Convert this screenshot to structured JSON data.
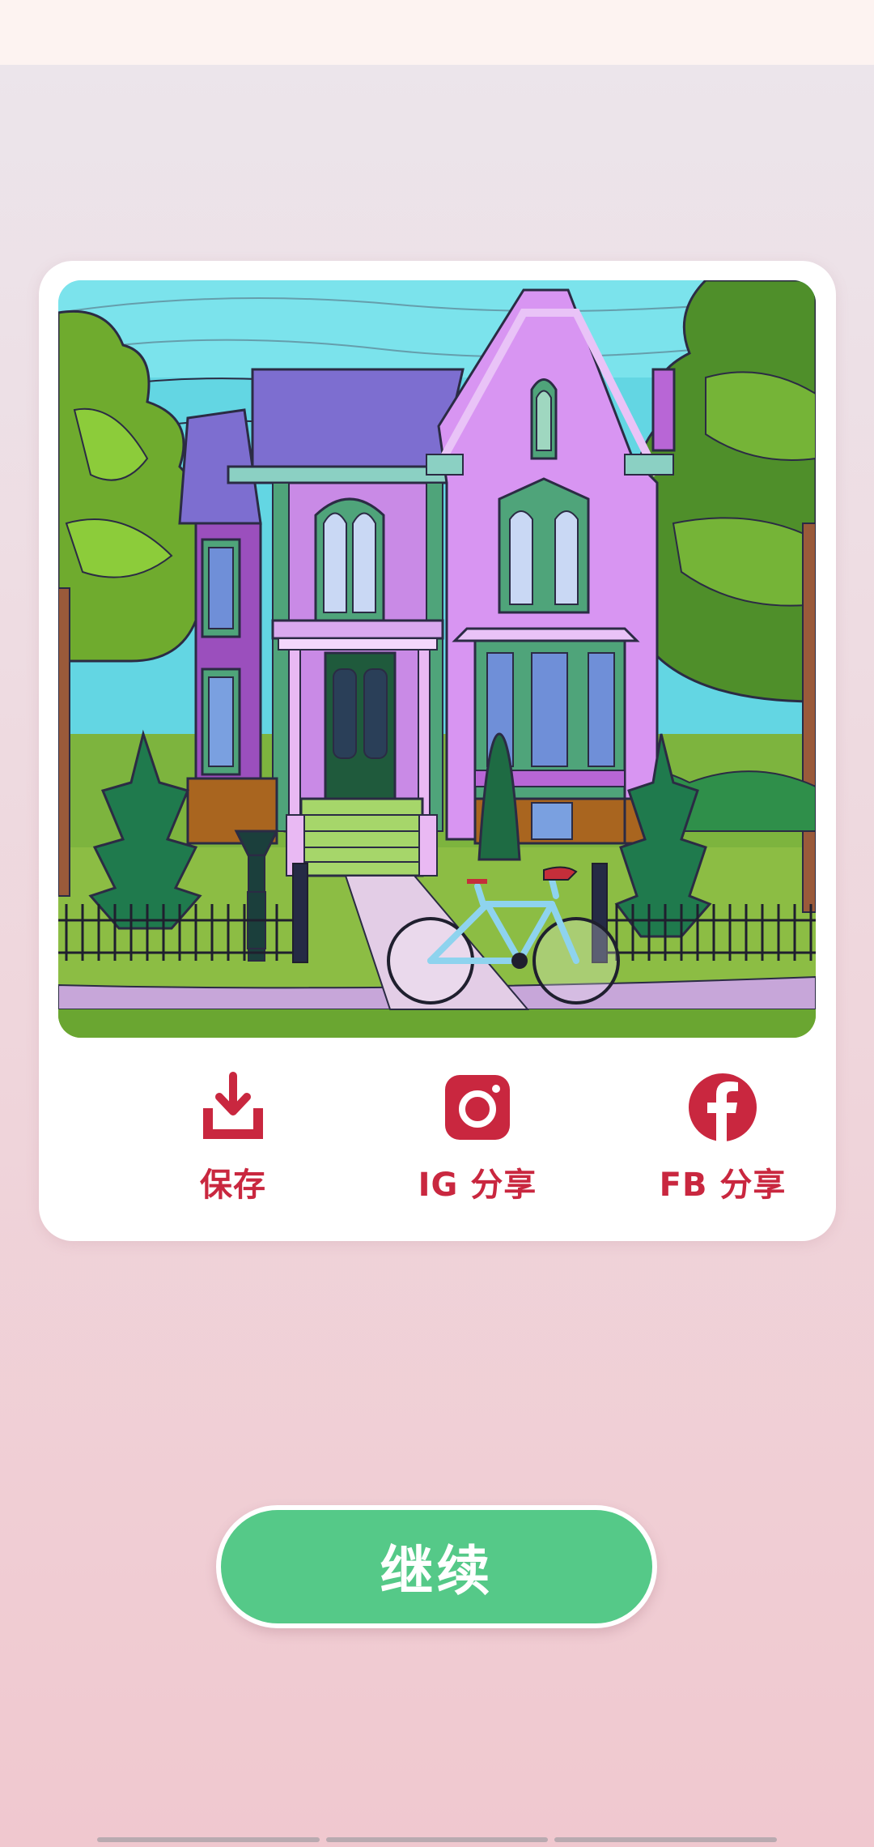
{
  "actions": {
    "save_label": "保存",
    "ig_label": "IG 分享",
    "fb_label": "FB 分享"
  },
  "continue_label": "继续",
  "colors": {
    "accent_red": "#c9273f",
    "continue_green": "#55c988",
    "card_background": "#ffffff"
  },
  "icons": {
    "save": "download-tray-icon",
    "ig": "instagram-icon",
    "fb": "facebook-icon"
  }
}
